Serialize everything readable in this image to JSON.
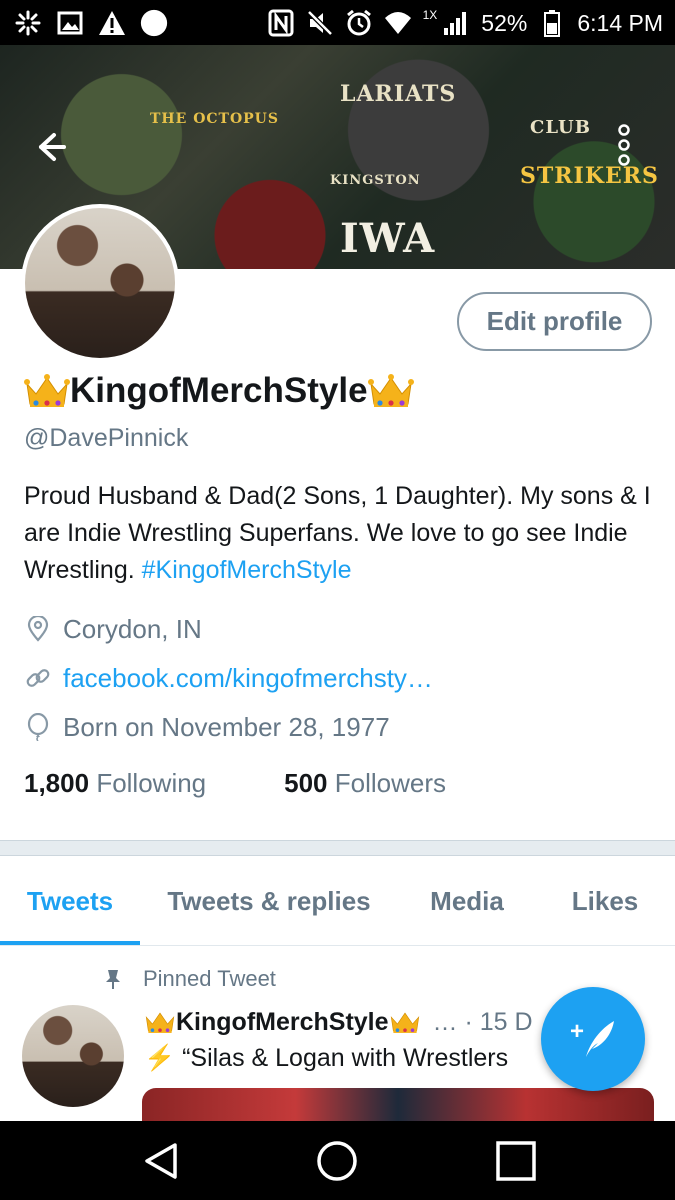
{
  "status_bar": {
    "left_icons": [
      "spark-icon",
      "gallery-icon",
      "alert-icon",
      "circle-icon"
    ],
    "right_icons": [
      "nfc-icon",
      "mute-icon",
      "alarm-icon",
      "wifi-icon",
      "signal-icon"
    ],
    "network_label": "1X",
    "battery": "52%",
    "time": "6:14 PM"
  },
  "header": {
    "back_icon": "back-arrow-icon",
    "more_icon": "more-vertical-icon",
    "banner_words": [
      "LARIATS",
      "THE OCTOPUS",
      "CLUB",
      "STRIKERS",
      "IWA",
      "KINGSTON"
    ]
  },
  "profile": {
    "edit_label": "Edit profile",
    "display_name": "KingofMerchStyle",
    "handle": "@DavePinnick",
    "bio_text": "Proud Husband & Dad(2 Sons, 1 Daughter). My sons & I are Indie Wrestling Superfans. We love to go see Indie Wrestling. ",
    "bio_hashtag": "#KingofMerchStyle",
    "location": "Corydon, IN",
    "website": "facebook.com/kingofmerchsty…",
    "birthday": "Born on November 28, 1977",
    "following_count": "1,800",
    "following_label": "Following",
    "followers_count": "500",
    "followers_label": "Followers"
  },
  "tabs": [
    {
      "label": "Tweets",
      "active": true
    },
    {
      "label": "Tweets & replies",
      "active": false
    },
    {
      "label": "Media",
      "active": false
    },
    {
      "label": "Likes",
      "active": false
    }
  ],
  "pinned_tweet": {
    "pinned_label": "Pinned Tweet",
    "author": "KingofMerchStyle",
    "meta": "… · 15 D",
    "text": "⚡ “Silas & Logan with Wrestlers"
  },
  "fab_label": "+",
  "colors": {
    "accent": "#1da1f2",
    "muted": "#657786",
    "text": "#14171a"
  }
}
